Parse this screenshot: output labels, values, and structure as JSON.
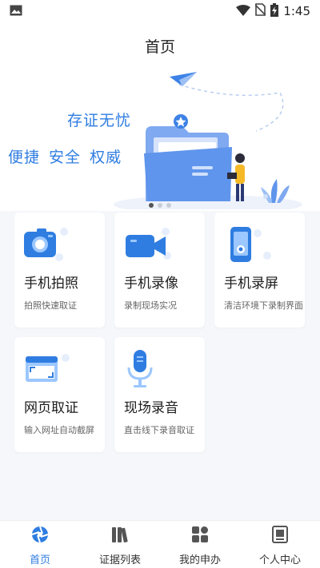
{
  "status": {
    "time": "1:45"
  },
  "page": {
    "title": "首页"
  },
  "hero": {
    "slogan_line1": "存证无忧",
    "slogan_line2": "便捷 安全 权威"
  },
  "carousel": {
    "count": 3,
    "active": 0
  },
  "cards": [
    {
      "title": "手机拍照",
      "subtitle": "拍照快速取证",
      "icon": "camera-icon"
    },
    {
      "title": "手机录像",
      "subtitle": "录制现场实况",
      "icon": "video-camera-icon"
    },
    {
      "title": "手机录屏",
      "subtitle": "清洁环境下录制界面",
      "icon": "phone-screen-icon"
    },
    {
      "title": "网页取证",
      "subtitle": "输入网址自动截屏",
      "icon": "webpage-icon"
    },
    {
      "title": "现场录音",
      "subtitle": "直击线下录音取证",
      "icon": "microphone-icon"
    }
  ],
  "tabbar": {
    "items": [
      {
        "label": "首页",
        "icon": "shutter-icon",
        "active": true
      },
      {
        "label": "证据列表",
        "icon": "books-icon",
        "active": false
      },
      {
        "label": "我的申办",
        "icon": "grid-icon",
        "active": false
      },
      {
        "label": "个人中心",
        "icon": "user-book-icon",
        "active": false
      }
    ]
  },
  "colors": {
    "accent": "#2f7de1",
    "background": "#f5f7fb"
  }
}
